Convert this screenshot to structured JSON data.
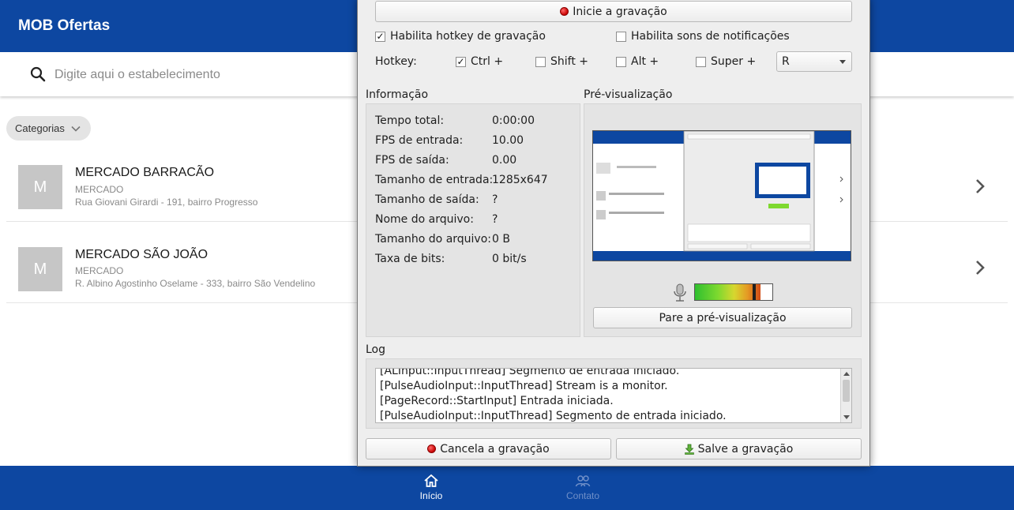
{
  "app": {
    "title": "MOB Ofertas",
    "search_placeholder": "Digite aqui o estabelecimento",
    "categories_label": "Categorias",
    "avatar_letter": "M",
    "stores": [
      {
        "name": "MERCADO BARRACÃO",
        "category": "MERCADO",
        "address": "Rua Giovani Girardi - 191, bairro Progresso"
      },
      {
        "name": "MERCADO SÃO JOÃO",
        "category": "MERCADO",
        "address": "R. Albino Agostinho Oselame - 333, bairro São Vendelino"
      }
    ],
    "nav": {
      "home": "Início",
      "contact": "Contato"
    },
    "colors": {
      "brand": "#0d47a1",
      "nav_inactive": "#6f8fc8"
    }
  },
  "recorder": {
    "start_button": "Inicie a gravação",
    "hotkey_enable": "Habilita hotkey de gravação",
    "hotkey_enable_checked": true,
    "notify_sounds": "Habilita sons de notificações",
    "notify_sounds_checked": false,
    "hotkey_label": "Hotkey:",
    "mods": [
      {
        "label": "Ctrl +",
        "checked": true
      },
      {
        "label": "Shift +",
        "checked": false
      },
      {
        "label": "Alt +",
        "checked": false
      },
      {
        "label": "Super +",
        "checked": false
      }
    ],
    "key_value": "R",
    "info_title": "Informação",
    "info": [
      {
        "label": "Tempo total:",
        "value": "0:00:00"
      },
      {
        "label": "FPS de entrada:",
        "value": "10.00"
      },
      {
        "label": "FPS de saída:",
        "value": "0.00"
      },
      {
        "label": "Tamanho de entrada:",
        "value": "1285x647"
      },
      {
        "label": "Tamanho de saída:",
        "value": "?"
      },
      {
        "label": "Nome do arquivo:",
        "value": "?"
      },
      {
        "label": "Tamanho do arquivo:",
        "value": "0 B"
      },
      {
        "label": "Taxa de bits:",
        "value": "0 bit/s"
      }
    ],
    "preview_title": "Pré-visualização",
    "stop_preview_button": "Pare a pré-visualização",
    "audio_level": 0.85,
    "log_title": "Log",
    "log_lines": [
      "[ALInput::InputThread] Segmento de entrada iniciado.",
      "[PulseAudioInput::InputThread] Stream is a monitor.",
      "[PageRecord::StartInput] Entrada iniciada.",
      "[PulseAudioInput::InputThread] Segmento de entrada iniciado."
    ],
    "cancel_button": "Cancela a gravação",
    "save_button": "Salve a gravação"
  }
}
